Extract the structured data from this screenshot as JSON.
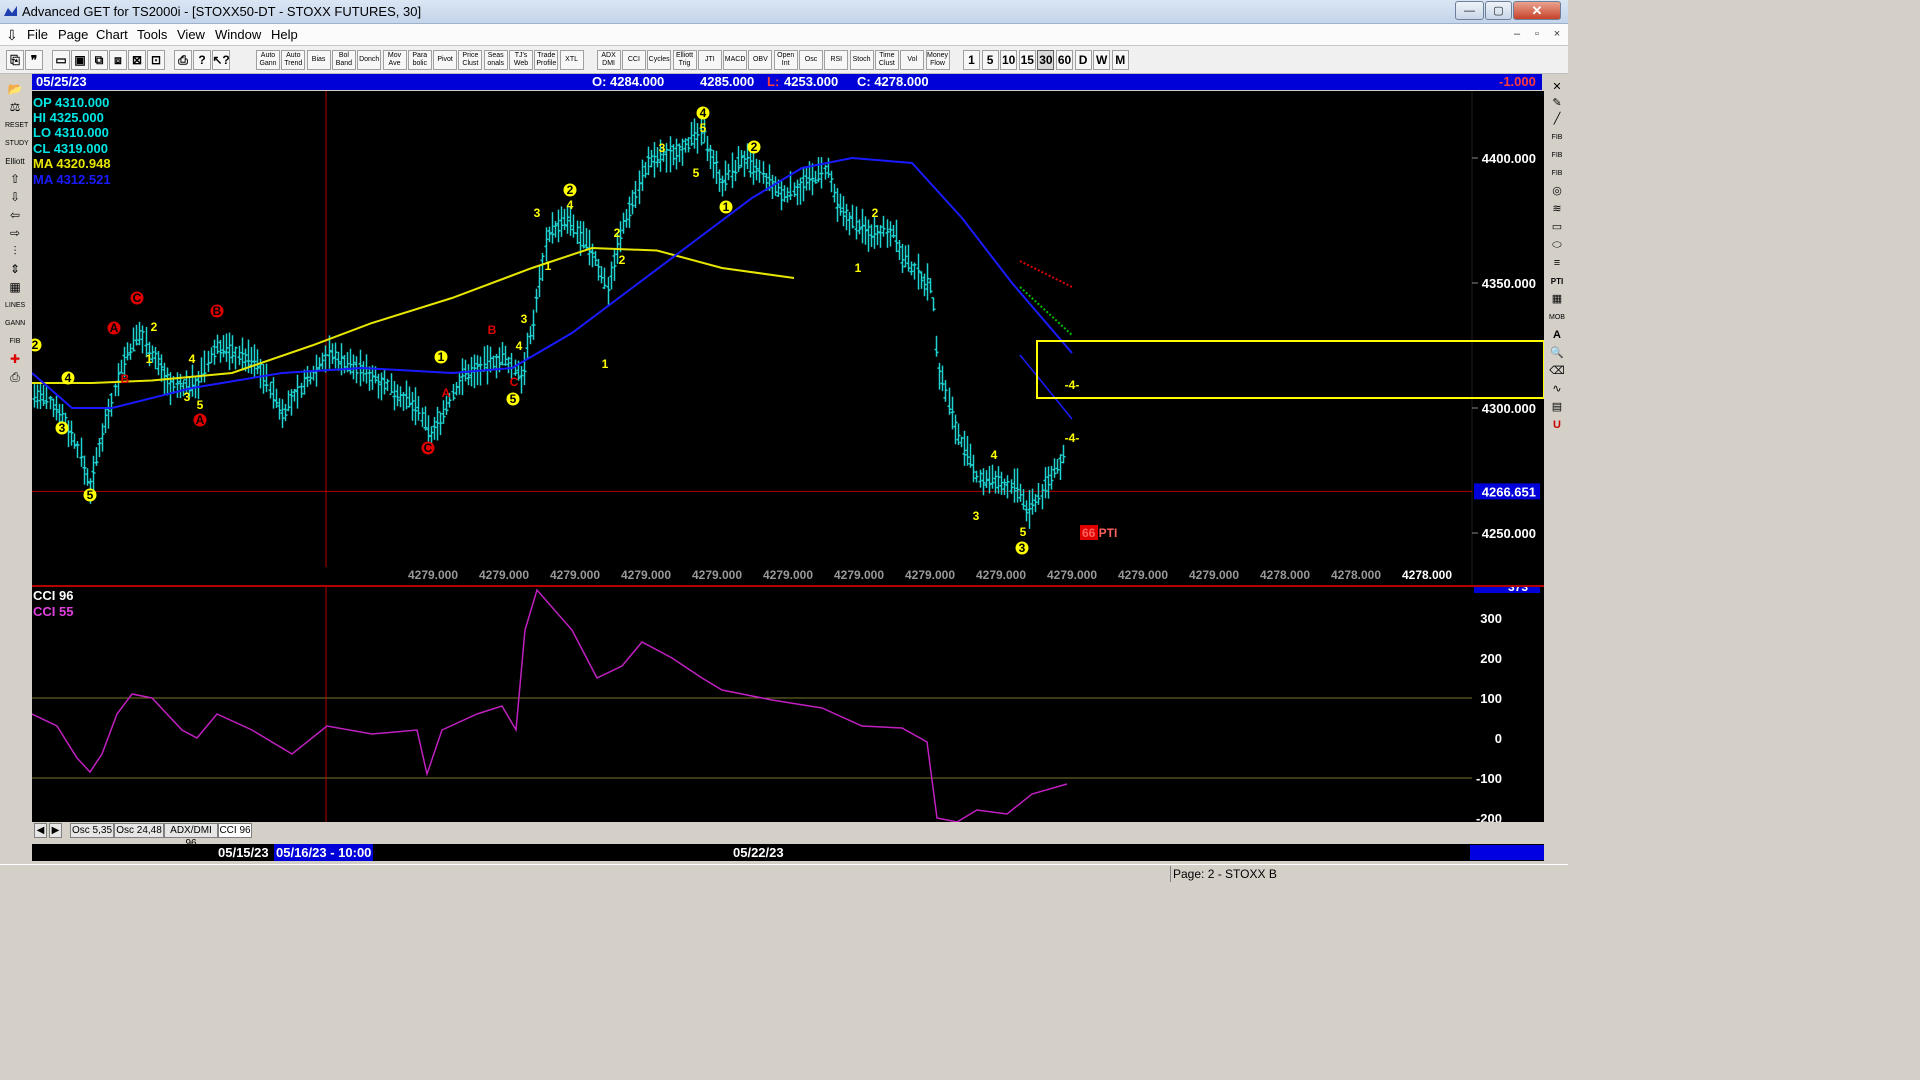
{
  "window": {
    "title": "Advanced GET for TS2000i - [STOXX50-DT - STOXX FUTURES, 30]",
    "buttons": {
      "minimize": "—",
      "maximize": "▢",
      "close": "✕"
    }
  },
  "menubar": {
    "items": [
      "File",
      "Page",
      "Chart",
      "Tools",
      "View",
      "Window",
      "Help"
    ],
    "mdi_buttons": [
      "–",
      "▫",
      "×"
    ]
  },
  "toolbar": {
    "icon_buttons": [
      "⎘",
      "❞",
      "▭",
      "▣",
      "⧉",
      "⧈",
      "⊠",
      "⊡",
      "⎙",
      "?",
      "↖?"
    ],
    "study_buttons": [
      "Auto Gann",
      "Auto Trend",
      "Bias",
      "Bol Band",
      "Donch",
      "Mov Ave",
      "Para bolic",
      "Pivot",
      "Price Clust",
      "Seas onals",
      "TJ's Web",
      "Trade Profile",
      "XTL",
      "ADX DMI",
      "CCI",
      "Cycles",
      "Elliott Trig",
      "JTI",
      "MACD",
      "OBV",
      "Open Int",
      "Osc",
      "RSI",
      "Stoch",
      "Time Clust",
      "Vol",
      "Money Flow"
    ],
    "timeframes": [
      "1",
      "5",
      "10",
      "15",
      "30",
      "60",
      "D",
      "W",
      "M"
    ],
    "active_timeframe": "30"
  },
  "header": {
    "date": "05/25/23",
    "open": "O: 4284.000",
    "high": "4285.000",
    "low_prefix": "L:",
    "low": "4253.000",
    "close": "C: 4278.000",
    "change": "-1.000"
  },
  "info_panel": {
    "op": "OP  4310.000",
    "hi": "HI   4325.000",
    "lo": "LO  4310.000",
    "cl": "CL  4319.000",
    "ma1": "MA  4320.948",
    "ma2": "MA  4312.521"
  },
  "price_axis": {
    "ticks": [
      "4400.000",
      "4350.000",
      "4300.000",
      "4250.000"
    ],
    "current_price": "4266.651"
  },
  "footer_prices": [
    "4279.000",
    "4279.000",
    "4279.000",
    "4279.000",
    "4279.000",
    "4279.000",
    "4279.000",
    "4279.000",
    "4279.000",
    "4279.000",
    "4279.000",
    "4279.000",
    "4278.000",
    "4278.000",
    "4278.000"
  ],
  "cci_panel": {
    "label1": "CCI 96",
    "label2": "CCI  55",
    "top_value": "373",
    "ticks": [
      "300",
      "200",
      "100",
      "0",
      "-100",
      "-200"
    ]
  },
  "elliott_labels": {
    "yellow": [
      "2",
      "4",
      "3",
      "5",
      "1",
      "2",
      "4",
      "3",
      "5",
      "1",
      "4",
      "3",
      "5",
      "3",
      "1",
      "2",
      "4",
      "2",
      "1",
      "2",
      "3",
      "5",
      "4",
      "5",
      "1",
      "2",
      "2",
      "1",
      "4",
      "3",
      "5",
      "3"
    ],
    "red": [
      "A",
      "C",
      "B",
      "B",
      "A",
      "C",
      "A",
      "B",
      "C"
    ],
    "projection": [
      "-4-",
      "-4-"
    ],
    "pti": "66 PTI"
  },
  "tabs": [
    "Osc 5,35",
    "Osc 24,48",
    "ADX/DMI 96",
    "CCI 96"
  ],
  "active_tab": "CCI 96",
  "dates": {
    "d1": "05/15/23",
    "selected": "05/16/23 - 10:00",
    "d2": "05/22/23"
  },
  "status": {
    "page": "Page: 2 - STOXX B"
  },
  "colors": {
    "price_bars": "#1fd3d3",
    "ma_yellow": "#e6e600",
    "ma_blue": "#1a1aff",
    "cci": "#c020c0",
    "header_blue": "#0000d8",
    "red_markers": "#e00000",
    "yellow_markers": "#ffff00"
  }
}
